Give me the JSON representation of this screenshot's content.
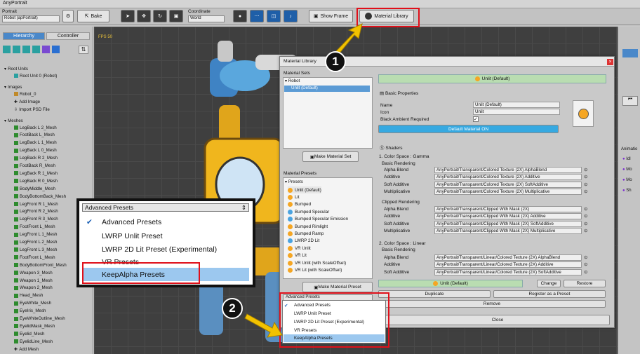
{
  "app_title": "AnyPortrait",
  "toolbar": {
    "portrait_label": "Portrait",
    "portrait_value": "Robot (apPortrait)",
    "bake": "Bake",
    "coordinate_label": "Coordinate",
    "coordinate_value": "World",
    "show_frame": "Show Frame",
    "material_library": "Material Library"
  },
  "left": {
    "tabs": [
      "Hierarchy",
      "Controller"
    ],
    "sections": {
      "root_units": "Root Units",
      "root_unit_item": "Root Unit 0 (Robot)",
      "images": "Images",
      "image_items": [
        "Robot_0",
        "Add Image",
        "Import PSD File"
      ],
      "meshes": "Meshes",
      "mesh_items": [
        "LegBack L 2_Mesh",
        "FootBack L_Mesh",
        "LegBack L 1_Mesh",
        "LegBack L 0_Mesh",
        "LegBack R 2_Mesh",
        "FootBack R_Mesh",
        "LegBack R 1_Mesh",
        "LegBack R 0_Mesh",
        "BodyMiddle_Mesh",
        "BodyBottomBack_Mesh",
        "LegFront R 1_Mesh",
        "LegFront R 2_Mesh",
        "LegFront R 3_Mesh",
        "FootFront L_Mesh",
        "LegFront L 1_Mesh",
        "LegFront L 2_Mesh",
        "LegFront L 3_Mesh",
        "FootFront L_Mesh",
        "BodyBottomFront_Mesh",
        "Weapon 3_Mesh",
        "Weapon 1_Mesh",
        "Weapon 2_Mesh",
        "Head_Mesh",
        "EyeWhite_Mesh",
        "EyeIris_Mesh",
        "EyeWhiteOutline_Mesh",
        "EyelidMask_Mesh",
        "Eyelid_Mesh",
        "EyelidLine_Mesh",
        "Add Mesh"
      ]
    }
  },
  "viewport": {
    "fps": "FPS 50"
  },
  "right": {
    "animation_label": "Animatio",
    "items": [
      "Idl",
      "Mo",
      "Mo",
      "Sh"
    ]
  },
  "dialog": {
    "title": "Material Library",
    "material_sets_label": "Material Sets",
    "tree_root": "Robot",
    "tree_item": "Unlit (Default)",
    "make_material_set": "Make Material Set",
    "material_presets_label": "Material Presets",
    "presets_root": "Presets",
    "presets": [
      {
        "name": "Unlit (Default)",
        "color": "#f5a623"
      },
      {
        "name": "Lit",
        "color": "#f5a623"
      },
      {
        "name": "Bumped",
        "color": "#f5a623"
      },
      {
        "name": "Bumped Specular",
        "color": "#4aa3e0"
      },
      {
        "name": "Bumped Specular Emission",
        "color": "#4aa3e0"
      },
      {
        "name": "Bumped Rimlight",
        "color": "#f5a623"
      },
      {
        "name": "Bumped Ramp",
        "color": "#f5a623"
      },
      {
        "name": "LWRP 2D Lit",
        "color": "#4aa3e0"
      },
      {
        "name": "VR Unlit",
        "color": "#f5a623"
      },
      {
        "name": "VR Lit",
        "color": "#f5a623"
      },
      {
        "name": "VR Unlit (with ScaleOffset)",
        "color": "#f5a623"
      },
      {
        "name": "VR Lit (with ScaleOffset)",
        "color": "#f5a623"
      }
    ],
    "make_material_preset": "Make Material Preset",
    "selected_header": "Unlit (Default)",
    "basic_properties": "Basic Properties",
    "name_label": "Name",
    "name_value": "Unlit (Default)",
    "icon_label": "Icon",
    "icon_value": "Unlit",
    "black_ambient_label": "Black Ambient Required",
    "default_material_on": "Default Material ON",
    "shaders": "Shaders",
    "gamma_header": "1. Color Space : Gamma",
    "basic_rendering": "Basic Rendering",
    "clipped_rendering": "Clipped Rendering",
    "linear_header": "2. Color Space : Linear",
    "shader_labels": [
      "Alpha Blend",
      "Additive",
      "Soft Additive",
      "Multiplicative"
    ],
    "gamma_basic": [
      "AnyPortrait/Transparent/Colored Texture (2X) AlphaBlend",
      "AnyPortrait/Transparent/Colored Texture (2X) Additive",
      "AnyPortrait/Transparent/Colored Texture (2X) SoftAdditive",
      "AnyPortrait/Transparent/Colored Texture (2X) Multiplicative"
    ],
    "gamma_clipped": [
      "AnyPortrait/Transparent/Clipped With Mask (2X)",
      "AnyPortrait/Transparent/Clipped With Mask (2X) Additive",
      "AnyPortrait/Transparent/Clipped With Mask (2X) SoftAdditive",
      "AnyPortrait/Transparent/Clipped With Mask (2X) Multiplicative"
    ],
    "linear_basic": [
      "AnyPortrait/Transparent/Linear/Colored Texture (2X) AlphaBlend",
      "AnyPortrait/Transparent/Linear/Colored Texture (2X) Additive",
      "AnyPortrait/Transparent/Linear/Colored Texture (2X) SoftAdditive"
    ],
    "bottom_selected": "Unlit (Default)",
    "change": "Change",
    "restore": "Restore",
    "duplicate": "Duplicate",
    "register": "Register as a Preset",
    "remove": "Remove",
    "close": "Close",
    "dropdown_value": "Advanced Presets",
    "dropdown_options": [
      "Advanced Presets",
      "LWRP Unlit Preset",
      "LWRP 2D Lit Preset (Experimental)",
      "VR Presets",
      "KeepAlpha Presets"
    ]
  },
  "callouts": {
    "one": "1",
    "two": "2"
  },
  "colors": {
    "highlight": "#e0101a",
    "arrow": "#f2c200",
    "selected_blue": "#9cc8ef",
    "accent_teal": "#36a9e1"
  }
}
